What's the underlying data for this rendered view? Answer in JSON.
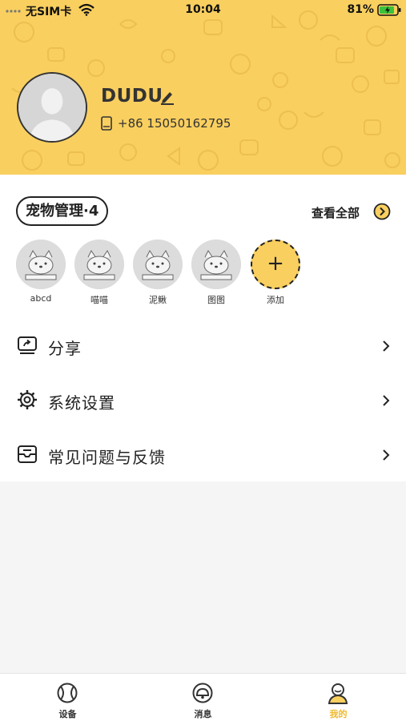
{
  "status_bar": {
    "carrier": "无SIM卡",
    "time": "10:04",
    "battery": "81%"
  },
  "profile": {
    "name": "DUDU",
    "phone": "+86 15050162795"
  },
  "pets": {
    "title": "宠物管理·4",
    "view_all": "查看全部",
    "items": [
      {
        "name": "abcd"
      },
      {
        "name": "喵喵"
      },
      {
        "name": "泥鳅"
      },
      {
        "name": "图图"
      }
    ],
    "add_label": "添加",
    "add_symbol": "+"
  },
  "menu": [
    {
      "label": "分享",
      "icon": "share-icon"
    },
    {
      "label": "系统设置",
      "icon": "gear-icon"
    },
    {
      "label": "常见问题与反馈",
      "icon": "feedback-icon"
    }
  ],
  "tabbar": [
    {
      "label": "设备",
      "icon": "ball-icon",
      "active": false
    },
    {
      "label": "消息",
      "icon": "bell-icon",
      "active": false
    },
    {
      "label": "我的",
      "icon": "person-icon",
      "active": true
    }
  ],
  "colors": {
    "accent": "#f9cf5f",
    "active_tab": "#f0b92e",
    "background": "#f5f5f5"
  }
}
